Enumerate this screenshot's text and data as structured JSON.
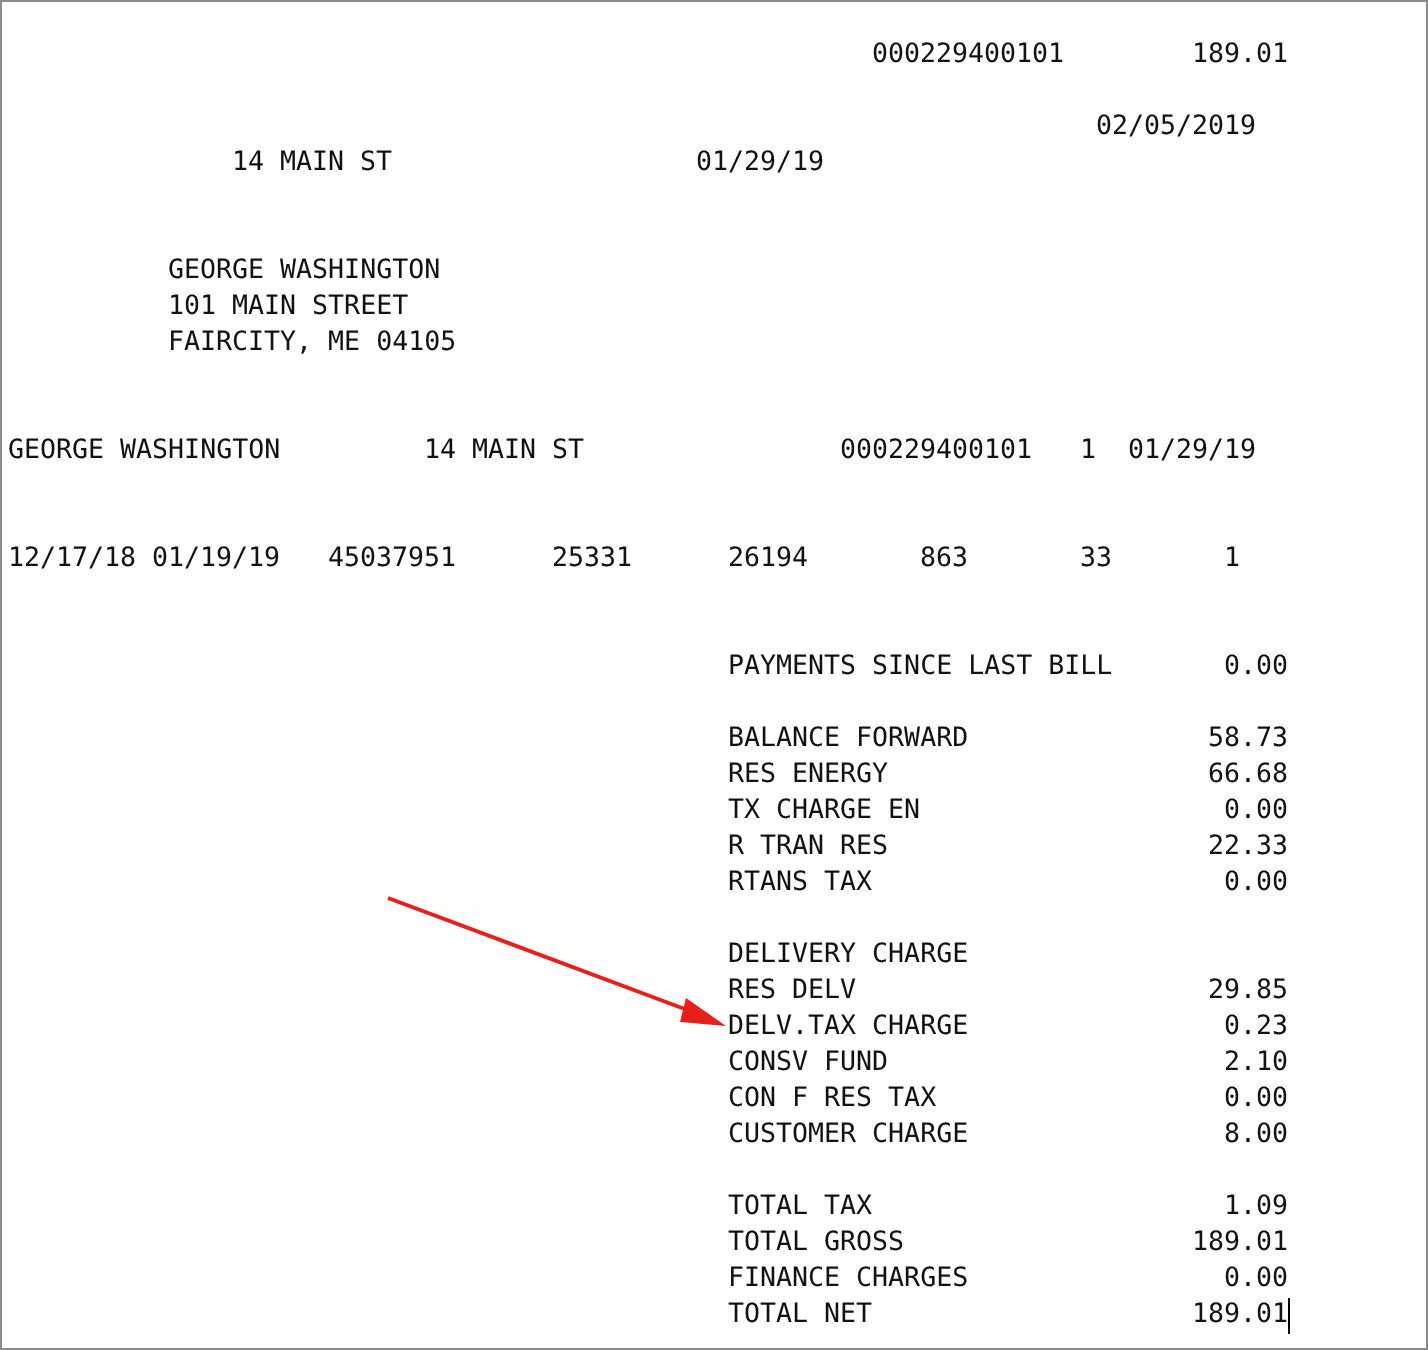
{
  "header": {
    "account_number": "000229400101",
    "amount_due": "189.01",
    "bill_date": "02/05/2019",
    "service_address": "14 MAIN ST",
    "due_date": "01/29/19"
  },
  "mailing_address": [
    "GEORGE WASHINGTON",
    "101 MAIN STREET",
    "FAIRCITY, ME 04105"
  ],
  "account_line": [
    "GEORGE WASHINGTON",
    "14 MAIN ST",
    "000229400101",
    "1",
    "01/29/19"
  ],
  "meter_line": [
    "12/17/18",
    "01/19/19",
    "45037951",
    "25331",
    "26194",
    "863",
    "33",
    "1"
  ],
  "charge_groups": [
    [
      {
        "label": "PAYMENTS SINCE LAST BILL",
        "amount": "0.00"
      }
    ],
    [
      {
        "label": "BALANCE FORWARD",
        "amount": "58.73"
      },
      {
        "label": "RES ENERGY",
        "amount": "66.68"
      },
      {
        "label": "TX CHARGE EN",
        "amount": "0.00"
      },
      {
        "label": "R TRAN RES",
        "amount": "22.33"
      },
      {
        "label": "RTANS TAX",
        "amount": "0.00"
      }
    ],
    [
      {
        "label": "DELIVERY CHARGE"
      },
      {
        "label": "RES DELV",
        "amount": "29.85"
      },
      {
        "label": "DELV.TAX CHARGE",
        "amount": "0.23"
      },
      {
        "label": "CONSV FUND",
        "amount": "2.10"
      },
      {
        "label": "CON F RES TAX",
        "amount": "0.00"
      },
      {
        "label": "CUSTOMER CHARGE",
        "amount": "8.00"
      }
    ],
    [
      {
        "label": "TOTAL TAX",
        "amount": "1.09"
      },
      {
        "label": "TOTAL GROSS",
        "amount": "189.01"
      },
      {
        "label": "FINANCE CHARGES",
        "amount": "0.00"
      },
      {
        "label": "TOTAL NET",
        "amount": "189.01"
      }
    ]
  ]
}
